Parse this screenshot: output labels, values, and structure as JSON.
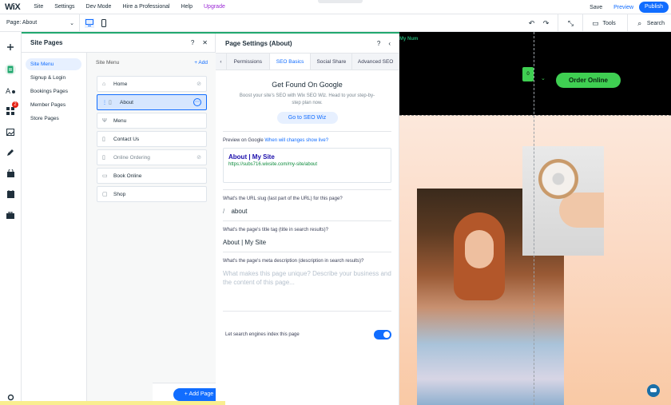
{
  "topbar": {
    "logo": "WiX",
    "menu": [
      "Site",
      "Settings",
      "Dev Mode",
      "Hire a Professional",
      "Help",
      "Upgrade"
    ],
    "save": "Save",
    "preview": "Preview",
    "publish": "Publish"
  },
  "subbar": {
    "page_label": "Page: About",
    "tools": "Tools",
    "search": "Search"
  },
  "site_pages": {
    "title": "Site Pages",
    "categories": [
      "Site Menu",
      "Signup & Login",
      "Bookings Pages",
      "Member Pages",
      "Store Pages"
    ],
    "list_header": "Site Menu",
    "add_label": "+ Add",
    "pages": [
      {
        "label": "Home",
        "icon": "home-icon",
        "hidden": true
      },
      {
        "label": "About",
        "icon": "page-icon",
        "selected": true
      },
      {
        "label": "Menu",
        "icon": "menu-icon"
      },
      {
        "label": "Contact Us",
        "icon": "page-icon"
      },
      {
        "label": "Online Ordering",
        "icon": "order-icon",
        "hidden": true
      },
      {
        "label": "Book Online",
        "icon": "book-icon"
      },
      {
        "label": "Shop",
        "icon": "shop-icon"
      }
    ],
    "add_page_label": "+ Add Page"
  },
  "page_settings": {
    "title": "Page Settings (About)",
    "tabs": [
      "Permissions",
      "SEO Basics",
      "Social Share",
      "Advanced SEO"
    ],
    "seo_title": "Get Found On Google",
    "seo_sub": "Boost your site's SEO with Wix SEO Wiz. Head to your step-by-step plan now.",
    "seo_button": "Go to SEO Wiz",
    "preview_label": "Preview on Google",
    "preview_link": "When will changes show live?",
    "preview_title": "About | My Site",
    "preview_url": "https://subs716.wixsite.com/my-site/about",
    "slug_label": "What's the URL slug (last part of the URL) for this page?",
    "slug_prefix": "/",
    "slug_value": "about",
    "title_label": "What's the page's title tag (title in search results)?",
    "title_value": "About | My Site",
    "desc_label": "What's the page's meta description (description in search results)?",
    "desc_placeholder": "What makes this page unique? Describe your business and the content of this page...",
    "index_label": "Let search engines index this page"
  },
  "canvas": {
    "site_name": "My Num",
    "cart_count": "0",
    "order_button": "Order Online"
  },
  "colors": {
    "accent": "#116dff",
    "green": "#3fcf52",
    "panel_divider": "#21a86f"
  }
}
